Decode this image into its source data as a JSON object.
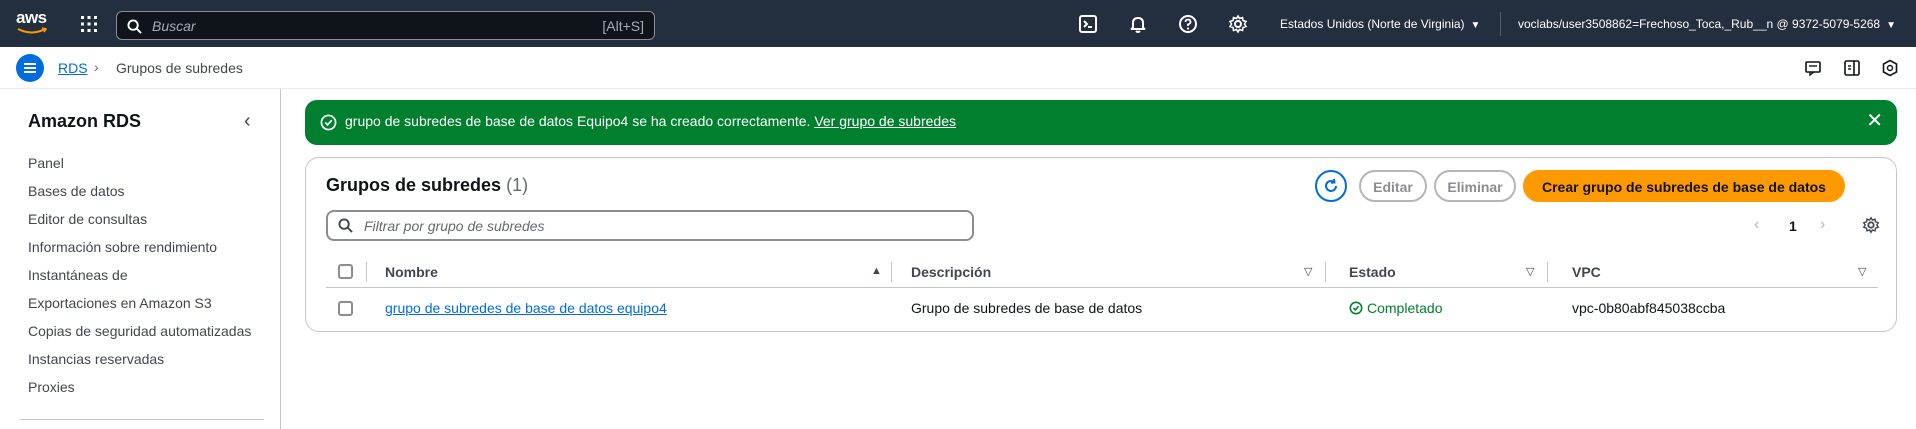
{
  "topnav": {
    "logo_text": "aws",
    "search_placeholder": "Buscar",
    "search_shortcut": "[Alt+S]",
    "region": "Estados Unidos (Norte de Virginia)",
    "account": "voclabs/user3508862=Frechoso_Toca,_Rub__n @ 9372-5079-5268",
    "icons": [
      "grid-icon",
      "cloudshell-icon",
      "bell-icon",
      "help-icon",
      "gear-icon"
    ]
  },
  "breadcrumb": {
    "root": "RDS",
    "current": "Grupos de subredes"
  },
  "sidebar": {
    "title": "Amazon RDS",
    "items": [
      "Panel",
      "Bases de datos",
      "Editor de consultas",
      "Información sobre rendimiento",
      "Instantáneas de",
      "Exportaciones en Amazon S3",
      "Copias de seguridad automatizadas",
      "Instancias reservadas",
      "Proxies"
    ]
  },
  "flash": {
    "message": "grupo de subredes de base de datos Equipo4 se ha creado correctamente.",
    "link": "Ver grupo de subredes",
    "color": "#00802f"
  },
  "panel": {
    "title": "Grupos de subredes",
    "count": "(1)",
    "edit_label": "Editar",
    "delete_label": "Eliminar",
    "create_label": "Crear grupo de subredes de base de datos",
    "filter_placeholder": "Filtrar por grupo de subredes",
    "page": "1"
  },
  "table": {
    "columns": [
      "Nombre",
      "Descripción",
      "Estado",
      "VPC"
    ],
    "rows": [
      {
        "name": "grupo de subredes de base de datos equipo4",
        "description": "Grupo de subredes de base de datos",
        "status": "Completado",
        "vpc": "vpc-0b80abf845038ccba"
      }
    ]
  },
  "colors": {
    "nav_bg": "#232f3e",
    "link": "#006ce0",
    "primary_button": "#ff9900",
    "success": "#00802f"
  }
}
